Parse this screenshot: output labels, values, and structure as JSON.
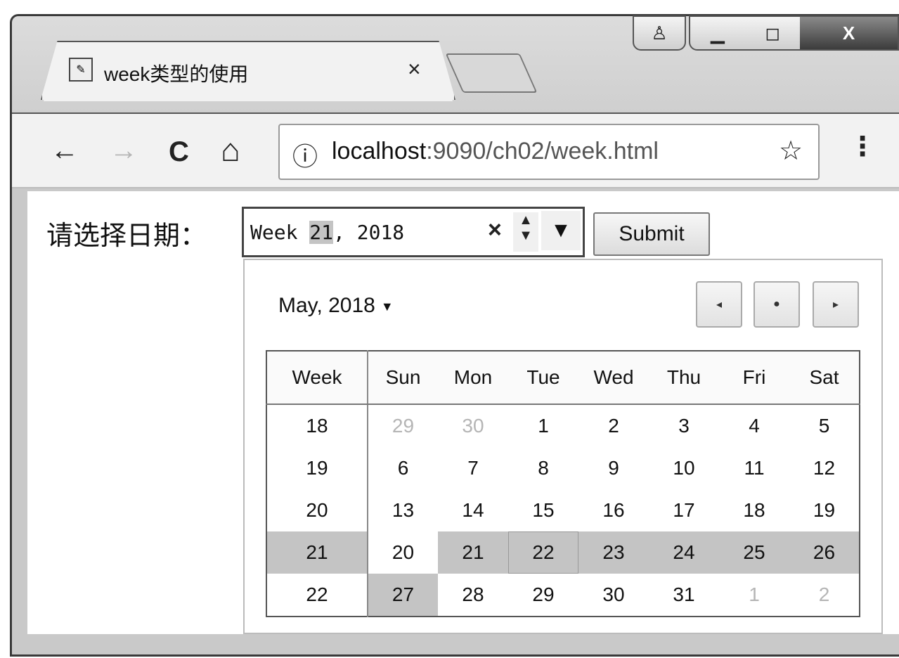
{
  "window": {
    "tab_title": "week类型的使用",
    "tab_close": "×",
    "controls": {
      "user": "♙",
      "minimize": "▁",
      "maximize": "◻",
      "close": "X"
    }
  },
  "toolbar": {
    "back": "←",
    "forward": "→",
    "reload": "C",
    "home": "⌂",
    "info_icon": "ⓘ",
    "url_host": "localhost",
    "url_rest": ":9090/ch02/week.html",
    "star": "☆",
    "menu": "⋮"
  },
  "form": {
    "label": "请选择日期：",
    "input_prefix": "Week ",
    "input_week": "21",
    "input_suffix": ", 2018",
    "clear": "×",
    "spin": "▲▼",
    "dropdown": "▼",
    "submit_label": "Submit"
  },
  "calendar": {
    "month_label": "May, 2018",
    "caret": "▼",
    "prev": "◂",
    "today": "●",
    "next": "▸",
    "headers": [
      "Week",
      "Sun",
      "Mon",
      "Tue",
      "Wed",
      "Thu",
      "Fri",
      "Sat"
    ],
    "rows": [
      {
        "week": "18",
        "days": [
          "29",
          "30",
          "1",
          "2",
          "3",
          "4",
          "5"
        ]
      },
      {
        "week": "19",
        "days": [
          "6",
          "7",
          "8",
          "9",
          "10",
          "11",
          "12"
        ]
      },
      {
        "week": "20",
        "days": [
          "13",
          "14",
          "15",
          "16",
          "17",
          "18",
          "19"
        ]
      },
      {
        "week": "21",
        "days": [
          "20",
          "21",
          "22",
          "23",
          "24",
          "25",
          "26"
        ]
      },
      {
        "week": "22",
        "days": [
          "27",
          "28",
          "29",
          "30",
          "31",
          "1",
          "2"
        ]
      }
    ],
    "selected_week": "21"
  }
}
